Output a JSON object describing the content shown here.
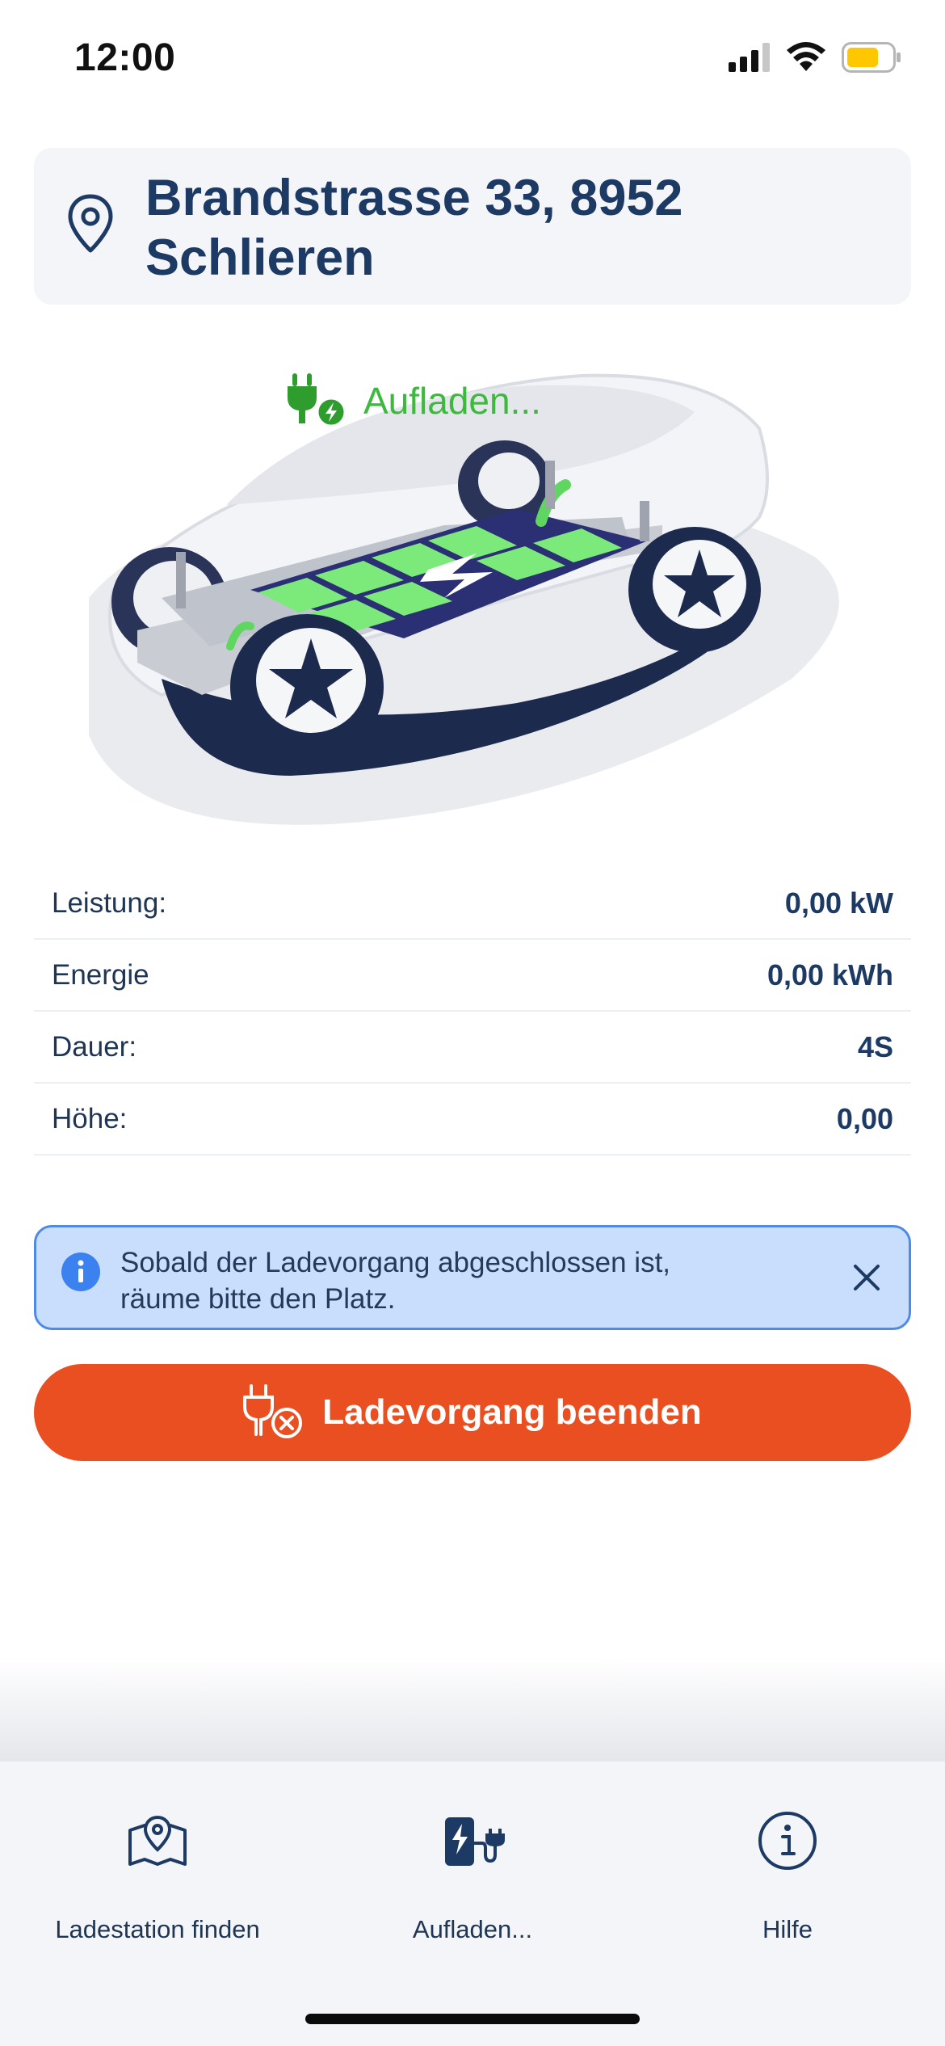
{
  "status_bar": {
    "time": "12:00",
    "battery_color": "#ffc700"
  },
  "address": {
    "text": "Brandstrasse 33, 8952 Schlieren",
    "icon": "location-pin-icon"
  },
  "charging": {
    "status": "Aufladen...",
    "icon": "plug-charging-icon",
    "color": "#3db93d"
  },
  "details": [
    {
      "label": "Leistung:",
      "value": "0,00 kW"
    },
    {
      "label": "Energie",
      "value": "0,00 kWh"
    },
    {
      "label": "Dauer:",
      "value": "4S"
    },
    {
      "label": "Höhe:",
      "value": "0,00"
    }
  ],
  "info_banner": {
    "icon": "info-icon",
    "line1": "Sobald der Ladevorgang abgeschlossen ist,",
    "line2": "räume bitte den Platz.",
    "close_icon": "close-icon"
  },
  "stop_button": {
    "label": "Ladevorgang beenden",
    "icon": "plug-cancel-icon",
    "color": "#e94f21"
  },
  "tab_bar": {
    "tabs": [
      {
        "label": "Ladestation finden",
        "icon": "map-pin-icon"
      },
      {
        "label": "Aufladen...",
        "icon": "charging-station-icon"
      },
      {
        "label": "Hilfe",
        "icon": "info-circle-icon"
      }
    ]
  },
  "colors": {
    "primary": "#1c3a63",
    "accent": "#e94f21",
    "success": "#3db93d",
    "info_bg": "#c9defc"
  }
}
